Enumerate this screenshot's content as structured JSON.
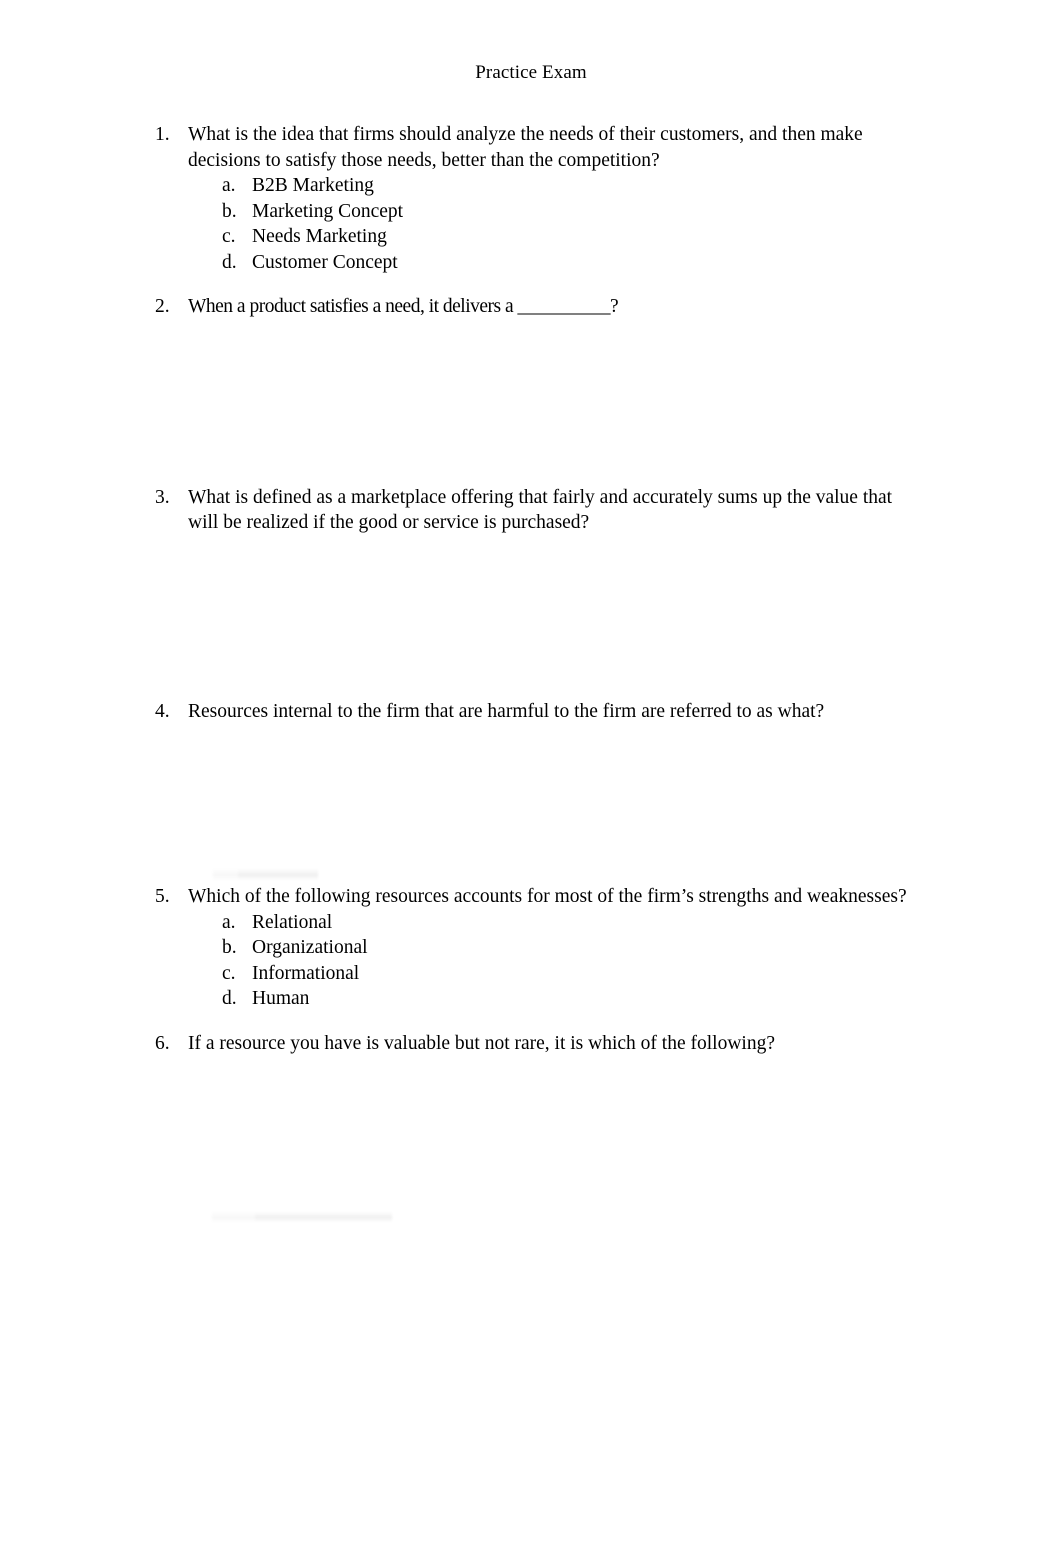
{
  "document": {
    "title": "Practice Exam"
  },
  "questions": [
    {
      "number": "1.",
      "text": "What is the idea that firms should analyze the needs of their customers, and then make decisions to satisfy those needs, better than the competition?",
      "options": [
        {
          "letter": "a.",
          "text": "B2B Marketing"
        },
        {
          "letter": "b.",
          "text": "Marketing Concept"
        },
        {
          "letter": "c.",
          "text": "Needs Marketing"
        },
        {
          "letter": "d.",
          "text": "Customer Concept"
        }
      ]
    },
    {
      "number": "2.",
      "text": "When a product satisfies a need, it delivers a __________?",
      "options": []
    },
    {
      "number": "3.",
      "text": "What is defined as a marketplace offering that fairly and accurately sums up the value that will be realized if the good or service is purchased?",
      "options": []
    },
    {
      "number": "4.",
      "text": "Resources internal to the firm that are harmful to the firm are referred to as what?",
      "options": []
    },
    {
      "number": "5.",
      "text": "Which of the following resources accounts for most of the firm’s strengths and weaknesses?",
      "options": [
        {
          "letter": "a.",
          "text": "Relational"
        },
        {
          "letter": "b.",
          "text": "Organizational"
        },
        {
          "letter": "c.",
          "text": "Informational"
        },
        {
          "letter": "d.",
          "text": "Human"
        }
      ]
    },
    {
      "number": "6.",
      "text": "If a resource you have is valuable but not rare, it is which of the following?",
      "options": []
    }
  ]
}
